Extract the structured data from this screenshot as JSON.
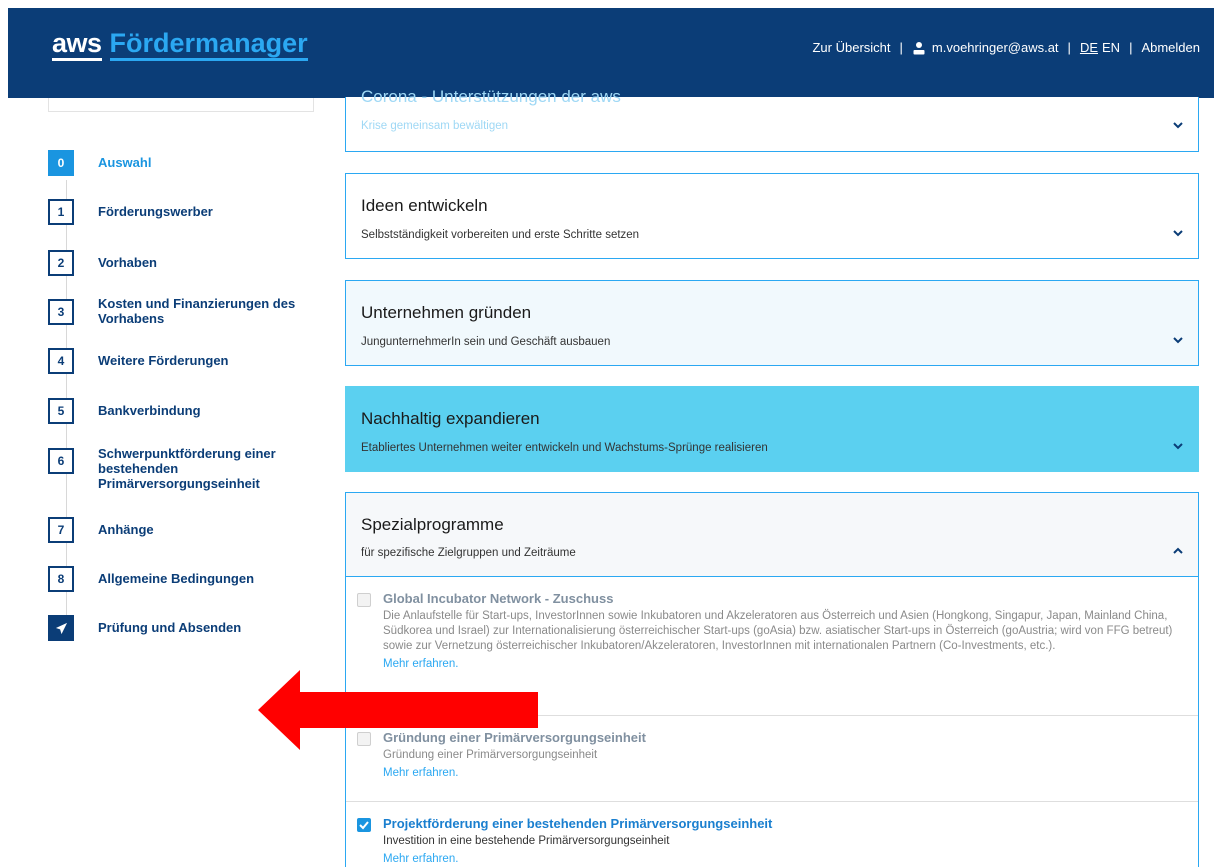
{
  "header": {
    "logo_aws": "aws",
    "logo_product": "Fördermanager",
    "nav": {
      "overview": "Zur Übersicht",
      "user": "m.voehringer@aws.at",
      "lang_de": "DE",
      "lang_en": "EN",
      "logout": "Abmelden",
      "separator": "|"
    }
  },
  "steps": [
    {
      "num": "0",
      "label": "Auswahl",
      "state": "active"
    },
    {
      "num": "1",
      "label": "Förderungswerber"
    },
    {
      "num": "2",
      "label": "Vorhaben"
    },
    {
      "num": "3",
      "label": "Kosten und Finanzierungen des Vorhabens"
    },
    {
      "num": "4",
      "label": "Weitere Förderungen"
    },
    {
      "num": "5",
      "label": "Bankverbindung"
    },
    {
      "num": "6",
      "label": "Schwerpunktförderung einer bestehenden Primärversorgungseinheit"
    },
    {
      "num": "7",
      "label": "Anhänge"
    },
    {
      "num": "8",
      "label": "Allgemeine Bedingungen"
    },
    {
      "num": "",
      "label": "Prüfung und Absenden",
      "icon": "paper-plane-icon"
    }
  ],
  "sections": [
    {
      "title": "Corona - Unterstützungen der aws",
      "subtitle": "Krise gemeinsam bewältigen",
      "expanded": false
    },
    {
      "title": "Ideen entwickeln",
      "subtitle": "Selbstständigkeit vorbereiten und erste Schritte setzen",
      "expanded": false
    },
    {
      "title": "Unternehmen gründen",
      "subtitle": "JungunternehmerIn sein und Geschäft ausbauen",
      "expanded": false
    },
    {
      "title": "Nachhaltig expandieren",
      "subtitle": "Etabliertes Unternehmen weiter entwickeln und Wachstums-Sprünge realisieren",
      "expanded": false
    },
    {
      "title": "Spezialprogramme",
      "subtitle": "für spezifische Zielgruppen und Zeiträume",
      "expanded": true
    }
  ],
  "programs": [
    {
      "title": "Global Incubator Network - Zuschuss",
      "desc": "Die Anlaufstelle für Start-ups, InvestorInnen sowie Inkubatoren und Akzeleratoren aus Österreich und Asien (Hongkong, Singapur, Japan, Mainland China, Südkorea und Israel) zur Internationalisierung österreichischer Start-ups (goAsia) bzw. asiatischer Start-ups in Österreich (goAustria; wird von FFG betreut) sowie zur Vernetzung österreichischer Inkubatoren/Akzeleratoren, InvestorInnen mit internationalen Partnern (Co-Investments, etc.).",
      "link": "Mehr erfahren.",
      "checked": false
    },
    {
      "title": "Gründung einer Primärversorgungseinheit",
      "desc": "Gründung einer Primärversorgungseinheit",
      "link": "Mehr erfahren.",
      "checked": false
    },
    {
      "title": "Projektförderung einer bestehenden Primärversorgungseinheit",
      "desc": "Investition in eine bestehende Primärversorgungseinheit",
      "link": "Mehr erfahren.",
      "checked": true
    }
  ],
  "colors": {
    "header_bg": "#0b3d77",
    "accent": "#2ba8f2",
    "active_step": "#1a95e0",
    "highlight_section": "#5bd0f0",
    "arrow": "#ff0000"
  }
}
